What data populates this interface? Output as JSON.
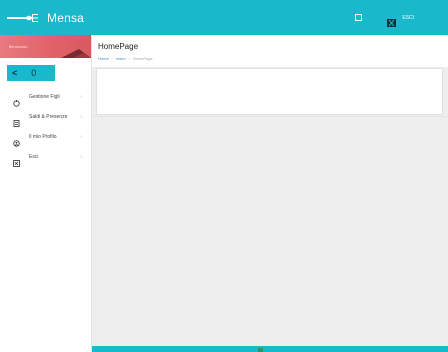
{
  "app": {
    "title": "Mensa",
    "exit_label": "ESCI",
    "brand_icon": "fork-icon",
    "accent_color": "#1ab8cb"
  },
  "sidebar": {
    "user_label": "Benvenuto",
    "banner_color": "#e06168",
    "back": {
      "arrow": "<",
      "count": "0"
    },
    "items": [
      {
        "label": "Gestione Figli",
        "icon": "child-icon"
      },
      {
        "label": "Saldi & Presenze",
        "icon": "ledger-icon"
      },
      {
        "label": "Il mio Profilo",
        "icon": "profile-icon"
      },
      {
        "label": "Esci",
        "icon": "exit-icon"
      }
    ]
  },
  "main": {
    "page_title": "HomePage",
    "breadcrumb": [
      "Home",
      "Index",
      "HomePage"
    ]
  }
}
